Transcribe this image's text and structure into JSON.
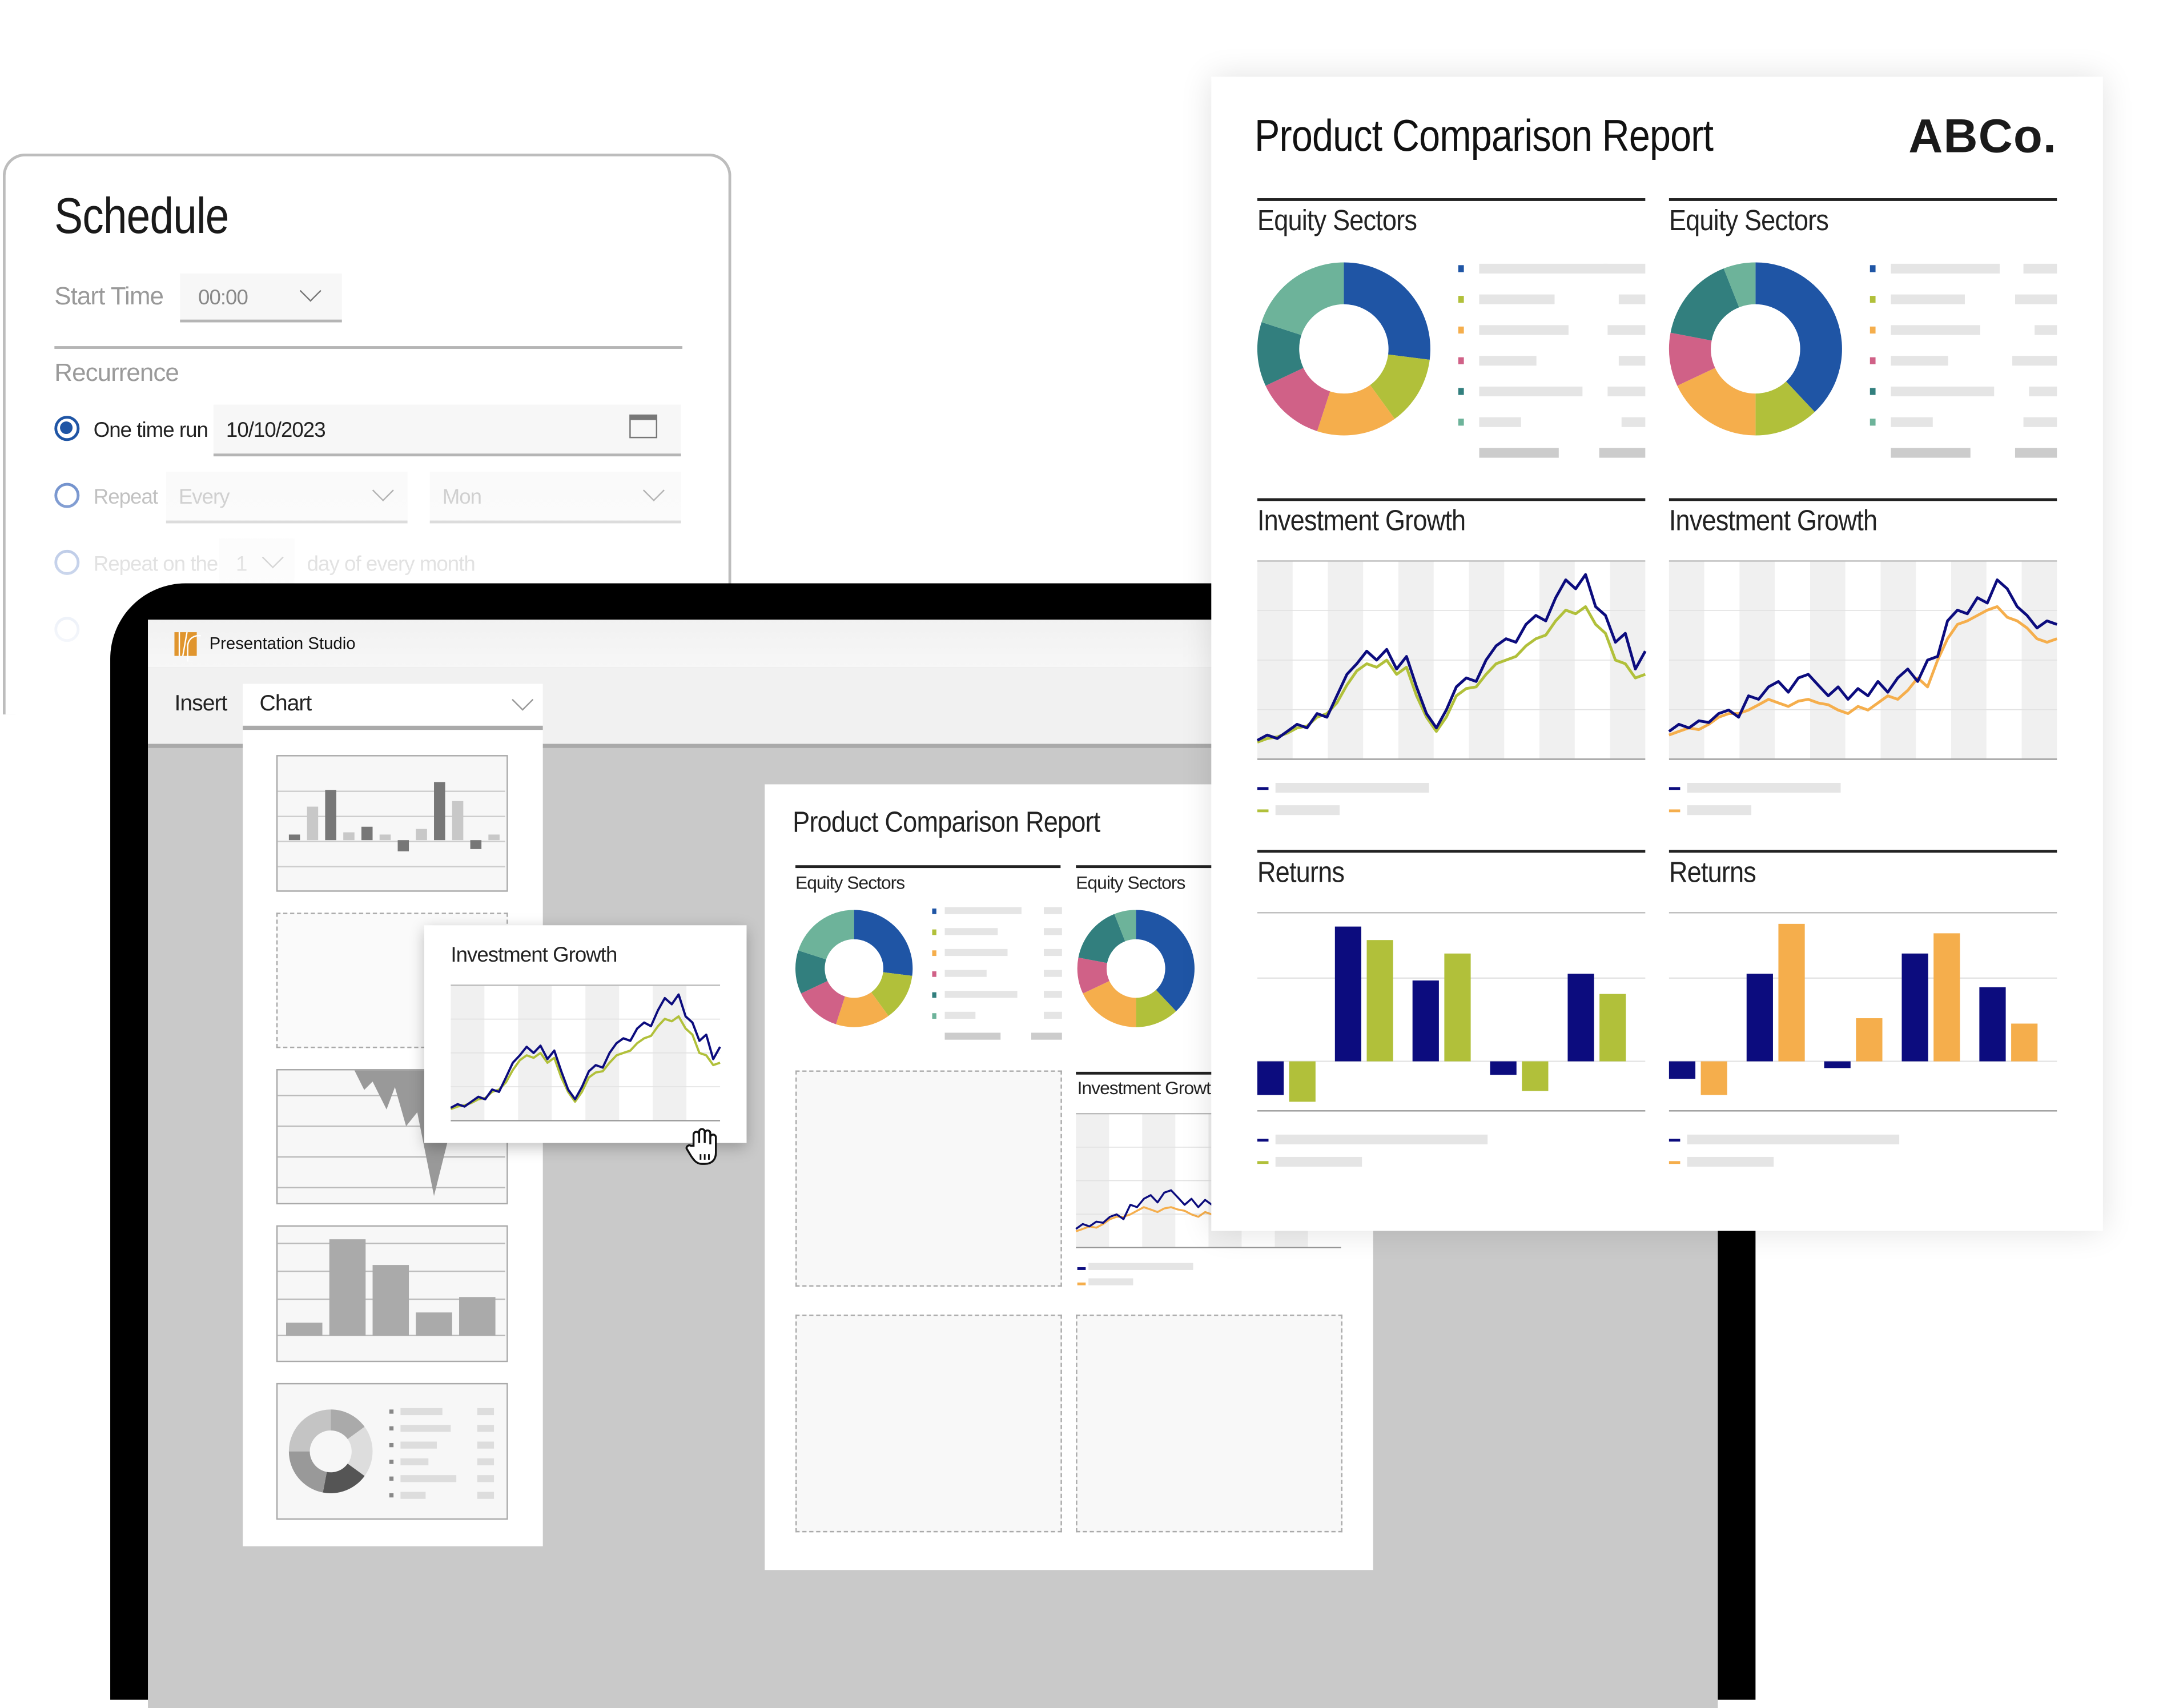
{
  "schedule": {
    "title": "Schedule",
    "start_time_label": "Start Time",
    "start_time_value": "00:00",
    "recurrence_label": "Recurrence",
    "one_time": {
      "label": "One time run",
      "selected": true,
      "date": "10/10/2023"
    },
    "repeat": {
      "label": "Repeat",
      "every": "Every",
      "day": "Mon"
    },
    "repeat_on": {
      "label": "Repeat on the",
      "day_num": "1",
      "suffix": "day of every month"
    }
  },
  "app": {
    "title": "Presentation Studio",
    "insert_label": "Insert",
    "insert_value": "Chart"
  },
  "drag_card": {
    "title": "Investment Growth"
  },
  "slide": {
    "title": "Product Comparison Report",
    "left_heading": "Equity Sectors",
    "right_heading": "Equity Sectors",
    "growth_heading": "Investment Growth"
  },
  "report": {
    "title": "Product Comparison Report",
    "logo": "ABCo.",
    "columns": [
      {
        "equity": "Equity Sectors",
        "growth": "Investment Growth",
        "returns": "Returns"
      },
      {
        "equity": "Equity Sectors",
        "growth": "Investment Growth",
        "returns": "Returns"
      }
    ]
  },
  "colors": {
    "accent_blue": "#1f55a5",
    "navy": "#0c0c7e",
    "green": "#b1c03a",
    "orange": "#f5ae4c",
    "pink": "#d06187",
    "teal": "#327f7e",
    "light_teal": "#6db39a",
    "logo_orange": "#e0952e"
  },
  "icons": [
    "chevron-down-icon",
    "calendar-icon",
    "radio-icon",
    "app-logo-icon",
    "hand-cursor-icon"
  ],
  "chart_data": [
    {
      "type": "pie",
      "id": "sectors_left",
      "title": "Equity Sectors",
      "values": [
        27,
        13,
        15,
        13,
        12,
        20
      ],
      "colors": [
        "#1f55a5",
        "#b1c03a",
        "#f5ae4c",
        "#d06187",
        "#327f7e",
        "#6db39a"
      ]
    },
    {
      "type": "pie",
      "id": "sectors_right",
      "title": "Equity Sectors",
      "values": [
        38,
        12,
        18,
        10,
        16,
        6
      ],
      "colors": [
        "#1f55a5",
        "#b1c03a",
        "#f5ae4c",
        "#d06187",
        "#327f7e",
        "#6db39a"
      ]
    },
    {
      "type": "line",
      "id": "growth_left",
      "title": "Investment Growth",
      "series": [
        {
          "color": "#0c0c7e",
          "values": [
            0.05,
            0.08,
            0.06,
            0.1,
            0.14,
            0.12,
            0.2,
            0.18,
            0.3,
            0.42,
            0.48,
            0.55,
            0.5,
            0.56,
            0.45,
            0.52,
            0.35,
            0.2,
            0.12,
            0.22,
            0.35,
            0.4,
            0.38,
            0.5,
            0.58,
            0.62,
            0.6,
            0.7,
            0.75,
            0.72,
            0.85,
            0.95,
            0.9,
            0.98,
            0.8,
            0.75,
            0.6,
            0.65,
            0.45,
            0.55
          ]
        },
        {
          "color": "#b1c03a",
          "values": [
            0.04,
            0.06,
            0.07,
            0.09,
            0.12,
            0.13,
            0.18,
            0.2,
            0.26,
            0.36,
            0.44,
            0.48,
            0.46,
            0.5,
            0.42,
            0.46,
            0.3,
            0.18,
            0.1,
            0.18,
            0.3,
            0.34,
            0.35,
            0.42,
            0.48,
            0.5,
            0.52,
            0.58,
            0.62,
            0.64,
            0.72,
            0.78,
            0.76,
            0.8,
            0.7,
            0.65,
            0.5,
            0.48,
            0.4,
            0.42
          ]
        }
      ]
    },
    {
      "type": "line",
      "id": "growth_right",
      "title": "Investment Growth",
      "series": [
        {
          "color": "#0c0c7e",
          "values": [
            0.1,
            0.14,
            0.12,
            0.16,
            0.15,
            0.2,
            0.22,
            0.18,
            0.3,
            0.28,
            0.35,
            0.38,
            0.32,
            0.4,
            0.42,
            0.36,
            0.3,
            0.35,
            0.28,
            0.34,
            0.3,
            0.38,
            0.32,
            0.4,
            0.45,
            0.38,
            0.5,
            0.52,
            0.72,
            0.78,
            0.76,
            0.85,
            0.82,
            0.95,
            0.9,
            0.8,
            0.75,
            0.68,
            0.72,
            0.7
          ]
        },
        {
          "color": "#f5ae4c",
          "values": [
            0.08,
            0.1,
            0.12,
            0.11,
            0.14,
            0.18,
            0.2,
            0.2,
            0.22,
            0.25,
            0.28,
            0.26,
            0.24,
            0.27,
            0.28,
            0.26,
            0.25,
            0.22,
            0.2,
            0.24,
            0.22,
            0.26,
            0.3,
            0.28,
            0.33,
            0.4,
            0.35,
            0.5,
            0.62,
            0.7,
            0.72,
            0.75,
            0.78,
            0.8,
            0.74,
            0.72,
            0.68,
            0.62,
            0.6,
            0.62
          ]
        }
      ]
    },
    {
      "type": "bar",
      "id": "returns_left",
      "title": "Returns",
      "series": [
        {
          "color": "#0c0c7e",
          "values": [
            -0.25,
            1.0,
            0.6,
            -0.1,
            0.65
          ]
        },
        {
          "color": "#b1c03a",
          "values": [
            -0.3,
            0.9,
            0.8,
            -0.22,
            0.5
          ]
        }
      ]
    },
    {
      "type": "bar",
      "id": "returns_right",
      "title": "Returns",
      "series": [
        {
          "color": "#0c0c7e",
          "values": [
            -0.13,
            0.65,
            -0.05,
            0.8,
            0.55
          ]
        },
        {
          "color": "#f5ae4c",
          "values": [
            -0.25,
            1.02,
            0.32,
            0.95,
            0.28
          ]
        }
      ]
    },
    {
      "type": "bar",
      "id": "thumb_bars",
      "values": [
        0.05,
        0.3,
        0.45,
        0.07,
        0.12,
        0.05,
        -0.1,
        0.1,
        0.52,
        0.35,
        -0.08,
        0.05
      ]
    },
    {
      "type": "bar",
      "id": "thumb_columns",
      "values": [
        0.1,
        0.75,
        0.55,
        0.18,
        0.3
      ]
    },
    {
      "type": "pie",
      "id": "thumb_donut",
      "values": [
        15,
        20,
        18,
        22,
        25
      ]
    }
  ]
}
